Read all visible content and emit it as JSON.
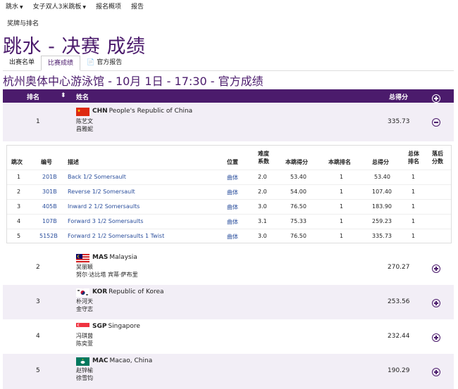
{
  "topnav": [
    {
      "label": "跳水",
      "dropdown": true
    },
    {
      "label": "女子双人3米跳板",
      "dropdown": true
    },
    {
      "label": "报名概项",
      "dropdown": false
    },
    {
      "label": "报告",
      "dropdown": false
    }
  ],
  "subnav": "奖牌与排名",
  "page_title": "跳水 - 决赛 成绩",
  "tabs": [
    {
      "label": "出赛名单"
    },
    {
      "label": "比赛成绩"
    },
    {
      "label": "官方报告"
    }
  ],
  "venue": "杭州奥体中心游泳馆 - 10月 1日 - 17:30 - 官方成绩",
  "table_header": {
    "rank": "排名",
    "sort": "⬍",
    "name": "姓名",
    "total": "总得分"
  },
  "rows": [
    {
      "rank": "1",
      "code": "CHN",
      "country": "People's Republic of China",
      "athletes": [
        "陈艺文",
        "昌雅妮"
      ],
      "total": "335.73",
      "expanded": true
    },
    {
      "rank": "2",
      "code": "MAS",
      "country": "Malaysia",
      "athletes": [
        "吴丽颖",
        "努尔·达比塔 宾蒂·萨布里"
      ],
      "total": "270.27",
      "expanded": false
    },
    {
      "rank": "3",
      "code": "KOR",
      "country": "Republic of Korea",
      "athletes": [
        "朴河天",
        "金守志"
      ],
      "total": "253.56",
      "expanded": false
    },
    {
      "rank": "4",
      "code": "SGP",
      "country": "Singapore",
      "athletes": [
        "冯琪茵",
        "陈奕萱"
      ],
      "total": "232.44",
      "expanded": false
    },
    {
      "rank": "5",
      "code": "MAC",
      "country": "Macao, China",
      "athletes": [
        "赵锌榆",
        "徐雪钧"
      ],
      "total": "190.29",
      "expanded": false
    }
  ],
  "detail_header": {
    "round": "跳次",
    "code": "编号",
    "desc": "描述",
    "pos": "位置",
    "dd": "难度系数",
    "score": "本跳得分",
    "rank": "本跳排名",
    "total": "总得分",
    "overall": "总体排名",
    "penalty": "落后分数"
  },
  "dives": [
    {
      "round": "1",
      "code": "201B",
      "desc": "Back 1/2 Somersault",
      "pos": "曲体",
      "dd": "2.0",
      "score": "53.40",
      "rank": "1",
      "total": "53.40",
      "overall": "1"
    },
    {
      "round": "2",
      "code": "301B",
      "desc": "Reverse 1/2 Somersault",
      "pos": "曲体",
      "dd": "2.0",
      "score": "54.00",
      "rank": "1",
      "total": "107.40",
      "overall": "1"
    },
    {
      "round": "3",
      "code": "405B",
      "desc": "Inward 2 1/2 Somersaults",
      "pos": "曲体",
      "dd": "3.0",
      "score": "76.50",
      "rank": "1",
      "total": "183.90",
      "overall": "1"
    },
    {
      "round": "4",
      "code": "107B",
      "desc": "Forward 3 1/2 Somersaults",
      "pos": "曲体",
      "dd": "3.1",
      "score": "75.33",
      "rank": "1",
      "total": "259.23",
      "overall": "1"
    },
    {
      "round": "5",
      "code": "5152B",
      "desc": "Forward 2 1/2 Somersaults 1 Twist",
      "pos": "曲体",
      "dd": "3.0",
      "score": "76.50",
      "rank": "1",
      "total": "335.73",
      "overall": "1"
    }
  ],
  "colors": {
    "brand": "#4b1b6c",
    "row_alt": "#f2eef6",
    "link": "#2a4e9c"
  }
}
